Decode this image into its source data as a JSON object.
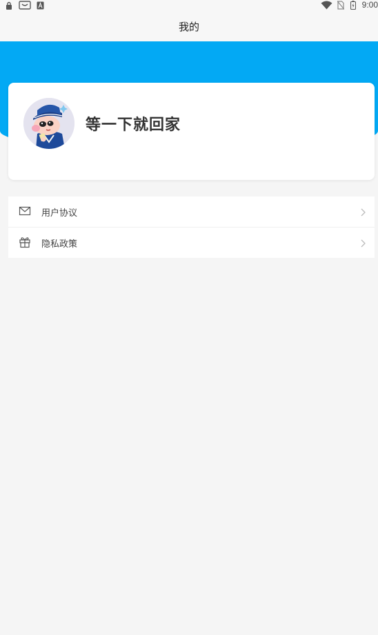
{
  "status_bar": {
    "time": "9:00",
    "left_icons": [
      "lock-icon",
      "android-icon",
      "keyboard-a-icon"
    ],
    "right_icons": [
      "wifi-icon",
      "no-sim-icon",
      "battery-charging-icon"
    ]
  },
  "header": {
    "title": "我的"
  },
  "colors": {
    "accent": "#03a9f4",
    "background": "#f5f5f5",
    "card": "#ffffff"
  },
  "profile": {
    "avatar_icon": "cartoon-boy-avatar",
    "username": "等一下就回家"
  },
  "menu": {
    "items": [
      {
        "label": "用户协议",
        "icon": "envelope-icon"
      },
      {
        "label": "隐私政策",
        "icon": "gift-icon"
      }
    ]
  }
}
